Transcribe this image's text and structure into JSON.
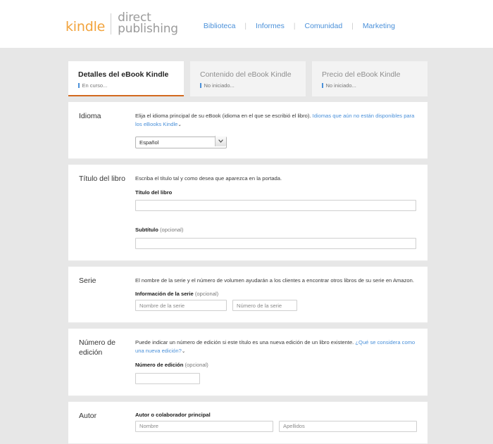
{
  "header": {
    "logo": {
      "brand": "kindle",
      "line1": "direct",
      "line2": "publishing"
    },
    "nav": [
      {
        "label": "Biblioteca"
      },
      {
        "label": "Informes"
      },
      {
        "label": "Comunidad"
      },
      {
        "label": "Marketing"
      }
    ],
    "nav_separator": "|"
  },
  "tabs": [
    {
      "title": "Detalles del eBook Kindle",
      "status": "En curso...",
      "active": true
    },
    {
      "title": "Contenido del eBook Kindle",
      "status": "No iniciado...",
      "active": false
    },
    {
      "title": "Precio del eBook Kindle",
      "status": "No iniciado...",
      "active": false
    }
  ],
  "sections": {
    "language": {
      "label": "Idioma",
      "description": "Elija el idioma principal de su eBook (idioma en el que se escribió el libro).",
      "link": "Idiomas que aún no están disponibles para los eBooks Kindle",
      "caret": "⌄",
      "selected": "Español",
      "options": [
        "Español"
      ]
    },
    "title": {
      "label": "Título del libro",
      "description": "Escriba el título tal y como desea que aparezca en la portada.",
      "title_field_label": "Título del libro",
      "title_value": "",
      "subtitle_field_label": "Subtítulo",
      "subtitle_optional": "(opcional)",
      "subtitle_value": ""
    },
    "series": {
      "label": "Serie",
      "description": "El nombre de la serie y el número de volumen ayudarán a los clientes a encontrar otros libros de su serie en Amazon.",
      "field_label": "Información de la serie",
      "optional": "(opcional)",
      "name_placeholder": "Nombre de la serie",
      "number_placeholder": "Número de la serie"
    },
    "edition": {
      "label": "Número de edición",
      "description": "Puede indicar un número de edición si este título es una nueva edición de un libro existente.",
      "link": "¿Qué se considera como una nueva edición?",
      "caret": "⌄",
      "field_label": "Número de edición",
      "optional": "(opcional)",
      "value": ""
    },
    "author": {
      "label": "Autor",
      "field_label": "Autor o colaborador principal",
      "first_name_placeholder": "Nombre",
      "last_name_placeholder": "Apellidos"
    }
  },
  "colors": {
    "brand_orange": "#f2a33c",
    "link_blue": "#4a90d9",
    "active_tab_underline": "#d2691e",
    "page_background": "#e7e7e7"
  }
}
